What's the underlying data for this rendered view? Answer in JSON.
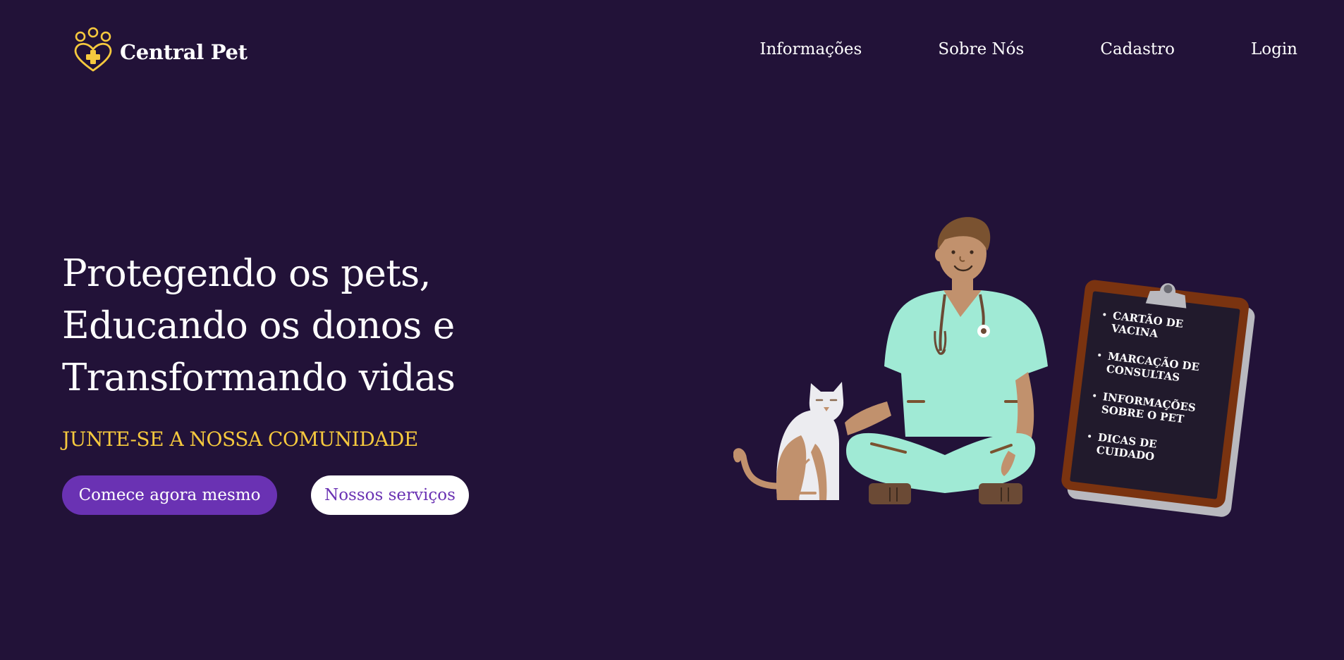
{
  "brand": {
    "name": "Central Pet",
    "icon": "paw-heart-cross-icon",
    "accent_color": "#f6c93e"
  },
  "nav": {
    "items": [
      {
        "label": "Informações"
      },
      {
        "label": "Sobre Nós"
      },
      {
        "label": "Cadastro"
      },
      {
        "label": "Login"
      }
    ]
  },
  "hero": {
    "title_lines": [
      "Protegendo os pets,",
      "Educando os donos e",
      "Transformando vidas"
    ],
    "subtitle": "JUNTE-SE A NOSSA COMUNIDADE",
    "primary_button": "Comece agora mesmo",
    "secondary_button": "Nossos serviços"
  },
  "clipboard": {
    "items": [
      "CARTÃO DE VACINA",
      "MARCAÇÃO DE CONSULTAS",
      "INFORMAÇÕES SOBRE O PET",
      "DICAS DE CUIDADO"
    ]
  },
  "colors": {
    "background": "#221238",
    "primary": "#6a32b3",
    "scrubs": "#a0ead5",
    "skin": "#c1916d",
    "hair": "#7a5230"
  }
}
